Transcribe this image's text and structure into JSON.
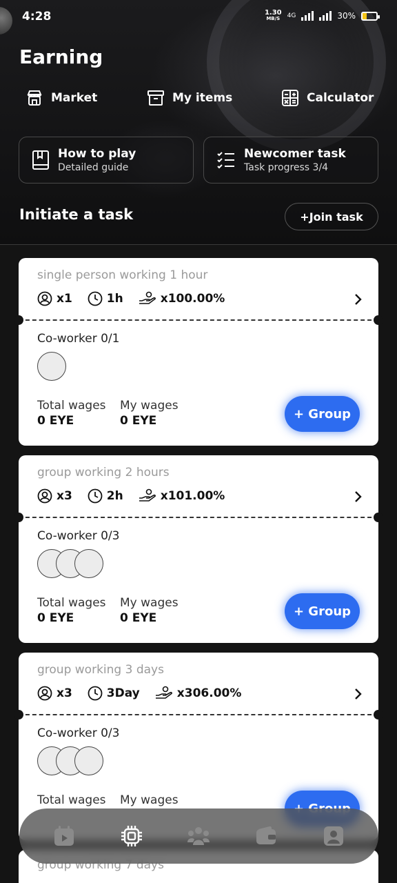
{
  "status_bar": {
    "time": "4:28",
    "net_speed_value": "1.30",
    "net_speed_unit": "MB/S",
    "network": "4G",
    "battery": "30%",
    "battery_level": 0.3
  },
  "page": {
    "title": "Earning"
  },
  "quick_links": [
    {
      "label": "Market",
      "icon": "market-icon"
    },
    {
      "label": "My items",
      "icon": "box-icon"
    },
    {
      "label": "Calculator",
      "icon": "calculator-icon"
    }
  ],
  "guide_cards": [
    {
      "title": "How to play",
      "subtitle": "Detailed guide",
      "icon": "book-icon"
    },
    {
      "title": "Newcomer task",
      "subtitle": "Task progress 3/4",
      "icon": "checklist-icon"
    }
  ],
  "section": {
    "title": "Initiate a task",
    "join_label": "+Join task"
  },
  "tasks": [
    {
      "name": "single person working 1 hour",
      "workers": "x1",
      "duration": "1h",
      "multiplier": "x100.00%",
      "coworker": "Co-worker 0/1",
      "total_wages_label": "Total wages",
      "total_wages": "0 EYE",
      "my_wages_label": "My wages",
      "my_wages": "0 EYE",
      "button": "+ Group"
    },
    {
      "name": "group working 2 hours",
      "workers": "x3",
      "duration": "2h",
      "multiplier": "x101.00%",
      "coworker": "Co-worker 0/3",
      "total_wages_label": "Total wages",
      "total_wages": "0 EYE",
      "my_wages_label": "My wages",
      "my_wages": "0 EYE",
      "button": "+ Group"
    },
    {
      "name": "group working 3 days",
      "workers": "x3",
      "duration": "3Day",
      "multiplier": "x306.00%",
      "coworker": "Co-worker 0/3",
      "total_wages_label": "Total wages",
      "total_wages": "",
      "my_wages_label": "My wages",
      "my_wages": "",
      "button": "+ Group"
    },
    {
      "name": "group working 7 days"
    }
  ],
  "bottom_nav": [
    {
      "icon": "calendar-play-icon",
      "active": false
    },
    {
      "icon": "chip-icon",
      "active": true
    },
    {
      "icon": "team-icon",
      "active": false
    },
    {
      "icon": "wallet-icon",
      "active": false
    },
    {
      "icon": "profile-icon",
      "active": false
    }
  ]
}
